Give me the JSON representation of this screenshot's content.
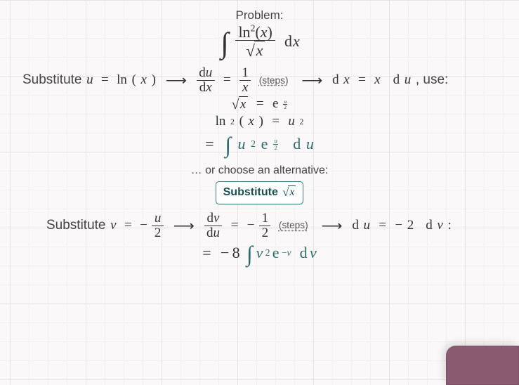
{
  "heading_problem": "Problem:",
  "integral_main": {
    "num_fn": "ln",
    "num_exp": "2",
    "num_arg": "x",
    "den_sqrt_arg": "x",
    "dx": "dx"
  },
  "sub_u": {
    "prefix": "Substitute ",
    "lhs_var": "u",
    "eq": "=",
    "fn": "ln",
    "arg": "x",
    "dfrac_top": "du",
    "dfrac_bot": "dx",
    "rfrac_top": "1",
    "rfrac_bot": "x",
    "steps": "(steps)",
    "out": "dx",
    "out_rhs_var": "x",
    "out_rhs_du": "du",
    "use": ", use:"
  },
  "use_lines": {
    "l1_lhs_sqrt": "x",
    "l1_eq": "=",
    "l1_e": "e",
    "l1_exp_top": "u",
    "l1_exp_bot": "2",
    "l2_fn": "ln",
    "l2_exp": "2",
    "l2_arg": "x",
    "l2_eq": "=",
    "l2_rhs_var": "u",
    "l2_rhs_exp": "2"
  },
  "result_u": {
    "eq": "=",
    "var": "u",
    "exp": "2",
    "e": "e",
    "e_exp_top": "u",
    "e_exp_bot": "2",
    "du": "du"
  },
  "alt_label": "… or choose an alternative:",
  "btn": {
    "label": "Substitute ",
    "sqrt_arg": "x"
  },
  "sub_v": {
    "prefix": "Substitute ",
    "var": "v",
    "eq": "=",
    "neg": "−",
    "f1_top": "u",
    "f1_bot": "2",
    "d_top": "dv",
    "d_bot": "du",
    "r_top": "1",
    "r_bot": "2",
    "steps": "(steps)",
    "out_lhs": "du",
    "out_eq": "=",
    "out_neg": "−",
    "out_coef": "2",
    "out_dv": "dv",
    "colon": ":"
  },
  "result_v": {
    "eq": "=",
    "neg": "−",
    "coef": "8",
    "v": "v",
    "exp": "2",
    "e": "e",
    "e_exp": "−v",
    "dv": "dv"
  }
}
